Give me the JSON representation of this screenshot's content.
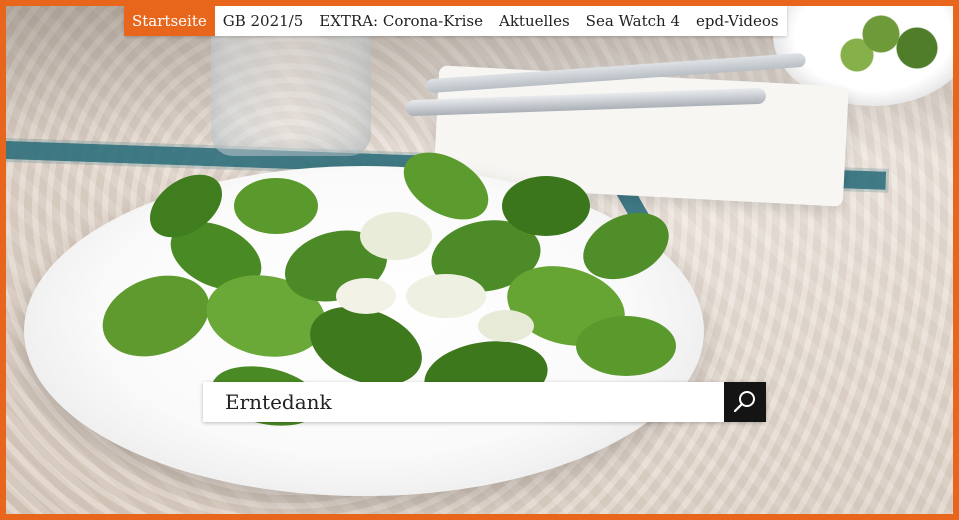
{
  "nav": {
    "items": [
      {
        "label": "Startseite",
        "active": true
      },
      {
        "label": "GB 2021/5",
        "active": false
      },
      {
        "label": "EXTRA: Corona-Krise",
        "active": false
      },
      {
        "label": "Aktuelles",
        "active": false
      },
      {
        "label": "Sea Watch 4",
        "active": false
      },
      {
        "label": "epd-Videos",
        "active": false
      }
    ]
  },
  "search": {
    "value": "Erntedank",
    "button_icon": "search-icon"
  },
  "colors": {
    "accent": "#e8661c",
    "search_button": "#141414"
  }
}
